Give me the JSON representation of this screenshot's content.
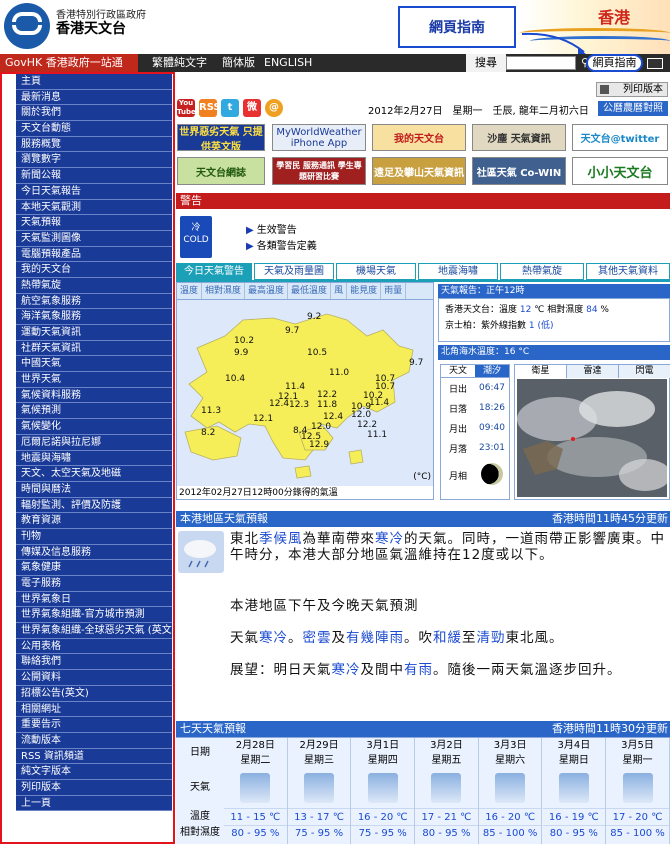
{
  "header": {
    "gov_name": "香港特別行政區政府",
    "obs_name": "香港天文台",
    "guide_callout": "網頁指南",
    "hk_brand": "香港"
  },
  "nav": {
    "govhk": "GovHK 香港政府一站通",
    "lang_trad": "繁體純文字",
    "lang_simp": "簡体版",
    "lang_en": "ENGLISH",
    "search_label": "搜尋",
    "search_placeholder": "",
    "guide_button": "網頁指南"
  },
  "sidebar": {
    "items": [
      "主頁",
      "最新消息",
      "關於我們",
      "天文台動態",
      "服務概覽",
      "瀏覽數字",
      "新聞公報",
      "今日天氣報告",
      "本地天氣觀測",
      "天氣預報",
      "天氣監測圖像",
      "電腦預報產品",
      "我的天文台",
      "熱帶氣旋",
      "航空氣象服務",
      "海洋氣象服務",
      "運動天氣資訊",
      "社群天氣資訊",
      "中國天氣",
      "世界天氣",
      "氣候資料服務",
      "氣候預測",
      "氣候變化",
      "厄爾尼諾與拉尼娜",
      "地震與海嘯",
      "天文、太空天氣及地磁",
      "時間與曆法",
      "輻射監測、評價及防護",
      "教育資源",
      "刊物",
      "傳媒及信息服務",
      "氣象健康",
      "電子服務",
      "世界氣象日",
      "世界氣象組織-官方城市預測",
      "世界氣象組織-全球惡劣天氣 (英文)",
      "公用表格",
      "聯絡我們",
      "公開資料",
      "招標公告(英文)",
      "相關網址",
      "重要告示",
      "流動版本",
      "RSS 資訊頻道",
      "純文字版本",
      "列印版本",
      "上一頁"
    ]
  },
  "topbar": {
    "print": "列印版本",
    "date": "2012年2月27日　星期一　壬辰, 龍年二月初六日",
    "almanac": "公曆農曆對照",
    "social": [
      "You Tube",
      "RSS",
      "t",
      "微",
      "@"
    ],
    "banners": [
      "世界惡劣天氣 只提供英文版",
      "MyWorldWeather iPhone App",
      "我的天文台",
      "沙塵 天氣資訊",
      "天文台@twitter",
      "天文台網誌",
      "學習民 服務通訊 學生專題研習比賽",
      "遠足及攀山天氣資訊",
      "社區天氣 Co-WIN",
      "小小天文台"
    ]
  },
  "warning": {
    "title": "警告",
    "icon_label": "冷 COLD",
    "links": [
      "生效警告",
      "各類警告定義"
    ]
  },
  "tabs": [
    "今日天氣警告",
    "天氣及雨量圖",
    "機場天氣",
    "地震海嘯",
    "熱帶氣旋",
    "其他天氣資料"
  ],
  "map": {
    "subtabs": [
      "溫度",
      "相對濕度",
      "最高溫度",
      "最低溫度",
      "風",
      "能見度",
      "雨量"
    ],
    "temps": [
      {
        "v": "9.2"
      },
      {
        "v": "10.2"
      },
      {
        "v": "9.9"
      },
      {
        "v": "9.7"
      },
      {
        "v": "10.5"
      },
      {
        "v": "9.7"
      },
      {
        "v": "10.4"
      },
      {
        "v": "11.0"
      },
      {
        "v": "10.7"
      },
      {
        "v": "11.4"
      },
      {
        "v": "12.1"
      },
      {
        "v": "12.4"
      },
      {
        "v": "12.3"
      },
      {
        "v": "12.2"
      },
      {
        "v": "10.2"
      },
      {
        "v": "11.3"
      },
      {
        "v": "11.8"
      },
      {
        "v": "10.9"
      },
      {
        "v": "12.4"
      },
      {
        "v": "12.0"
      },
      {
        "v": "11.4"
      },
      {
        "v": "8.2"
      },
      {
        "v": "12.1"
      },
      {
        "v": "8.4"
      },
      {
        "v": "12.0"
      },
      {
        "v": "12.5"
      },
      {
        "v": "12.9"
      },
      {
        "v": "12.2"
      },
      {
        "v": "11.1"
      },
      {
        "v": "10.7"
      }
    ],
    "unit": "(°C)",
    "caption": "2012年02月27日12時00分錄得的氣溫"
  },
  "forecast": {
    "title": "天氣報告：正午12時",
    "line1_label": "香港天文台：溫度",
    "line1_temp": "12",
    "line1_unit": "℃",
    "line1_rh_label": "相對濕度",
    "line1_rh": "84",
    "line1_rh_unit": "%",
    "line2_label": "京士柏：紫外線指數",
    "line2_uv": "1",
    "line2_uv_level": "(低)",
    "sea": "北角海水溫度：16 °C"
  },
  "astro": {
    "tabs": [
      "天文",
      "潮汐"
    ],
    "rows": [
      {
        "label": "日出",
        "value": "06:47"
      },
      {
        "label": "日落",
        "value": "18:26"
      },
      {
        "label": "月出",
        "value": "09:40"
      },
      {
        "label": "月落",
        "value": "23:01"
      },
      {
        "label": "月相",
        "value": ""
      }
    ]
  },
  "satellite": {
    "tabs": [
      "衛星",
      "雷達",
      "閃電"
    ]
  },
  "local": {
    "title": "本港地區天氣預報",
    "time": "香港時間11時45分更新",
    "p1": "東北季候風為華南帶來寒冷的天氣。同時，一道雨帶正影響廣東。中午時分，本港大部分地區氣溫維持在12度或以下。",
    "p2": "本港地區下午及今晚天氣預測",
    "p3": "天氣寒冷。密雲及有幾陣雨。吹和緩至清勁東北風。",
    "p4": "展望：明日天氣寒冷及間中有雨。隨後一兩天氣溫逐步回升。"
  },
  "seven": {
    "title": "七天天氣預報",
    "time": "香港時間11時30分更新",
    "labels": {
      "date": "日期",
      "wx": "天氣",
      "temp": "溫度",
      "rh": "相對濕度"
    },
    "days": [
      {
        "date": "2月28日",
        "wd": "星期二",
        "temp": "11 - 15 ℃",
        "rh": "80 - 95 %"
      },
      {
        "date": "2月29日",
        "wd": "星期三",
        "temp": "13 - 17 ℃",
        "rh": "75 - 95 %"
      },
      {
        "date": "3月1日",
        "wd": "星期四",
        "temp": "16 - 20 ℃",
        "rh": "75 - 95 %"
      },
      {
        "date": "3月2日",
        "wd": "星期五",
        "temp": "17 - 21 ℃",
        "rh": "80 - 95 %"
      },
      {
        "date": "3月3日",
        "wd": "星期六",
        "temp": "16 - 20 ℃",
        "rh": "85 - 100 %"
      },
      {
        "date": "3月4日",
        "wd": "星期日",
        "temp": "16 - 19 ℃",
        "rh": "80 - 95 %"
      },
      {
        "date": "3月5日",
        "wd": "星期一",
        "temp": "17 - 20 ℃",
        "rh": "85 - 100 %"
      }
    ]
  },
  "colors": {
    "accent": "#2a66c8",
    "sidebar": "#1a3a98",
    "warn": "#c41c1c",
    "tab": "#1ca0b8",
    "highlight": "#e4141c"
  }
}
